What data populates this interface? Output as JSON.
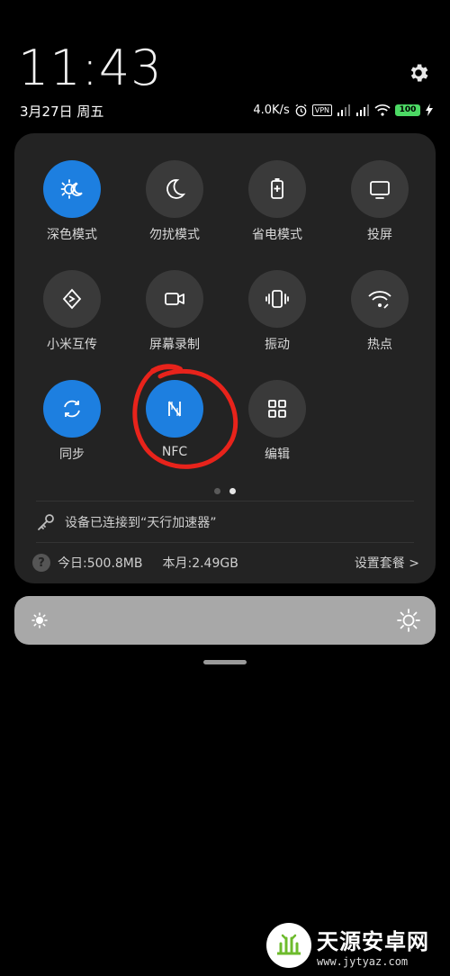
{
  "header": {
    "time": "11:43",
    "date": "3月27日 周五"
  },
  "status_bar": {
    "network_speed": "4.0K/s",
    "vpn_label": "VPN",
    "battery_level": "100",
    "icons": [
      "alarm-icon",
      "vpn-icon",
      "signal-icon",
      "signal-icon",
      "wifi-icon",
      "battery-icon",
      "charging-icon"
    ]
  },
  "tiles": [
    {
      "label": "深色模式",
      "icon": "dark-mode-icon",
      "active": true
    },
    {
      "label": "勿扰模式",
      "icon": "moon-icon",
      "active": false
    },
    {
      "label": "省电模式",
      "icon": "battery-saver-icon",
      "active": false
    },
    {
      "label": "投屏",
      "icon": "cast-screen-icon",
      "active": false
    },
    {
      "label": "小米互传",
      "icon": "mi-share-icon",
      "active": false
    },
    {
      "label": "屏幕录制",
      "icon": "screen-record-icon",
      "active": false
    },
    {
      "label": "振动",
      "icon": "vibrate-icon",
      "active": false
    },
    {
      "label": "热点",
      "icon": "hotspot-icon",
      "active": false
    },
    {
      "label": "同步",
      "icon": "sync-icon",
      "active": true
    },
    {
      "label": "NFC",
      "icon": "nfc-icon",
      "active": true
    },
    {
      "label": "编辑",
      "icon": "edit-grid-icon",
      "active": false
    }
  ],
  "pagination": {
    "pages": 2,
    "current": 2
  },
  "wifi_status": "设备已连接到“天行加速器”",
  "data_usage": {
    "today": "今日:500.8MB",
    "month": "本月:2.49GB",
    "plan_link": "设置套餐 >",
    "help_glyph": "?"
  },
  "watermark": {
    "name": "天源安卓网",
    "url": "www.jytyaz.com"
  },
  "colors": {
    "accent": "#1d7fe0",
    "panel": "#232323",
    "annotation": "#e8231b",
    "battery": "#4cd964"
  }
}
